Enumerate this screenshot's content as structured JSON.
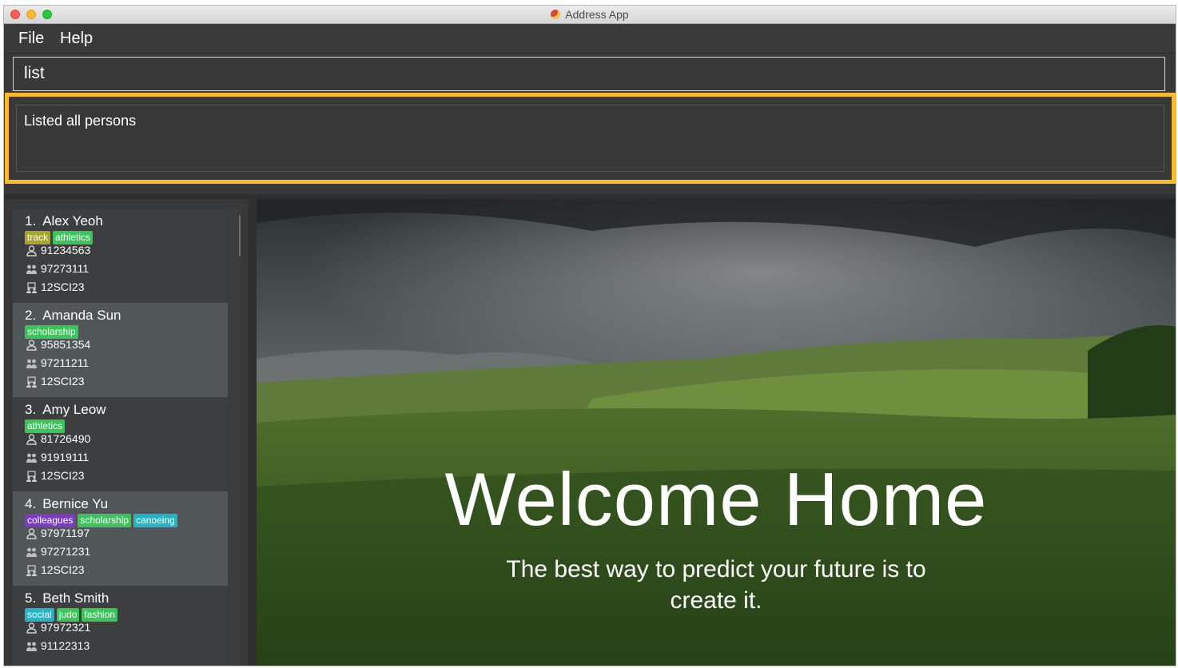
{
  "window": {
    "title": "Address App"
  },
  "menu": {
    "items": [
      "File",
      "Help"
    ]
  },
  "command": {
    "value": "list"
  },
  "result": {
    "text": "Listed all persons"
  },
  "persons": [
    {
      "index": "1.",
      "name": "Alex Yeoh",
      "tags": [
        {
          "label": "track",
          "color": "#a7a52f"
        },
        {
          "label": "athletics",
          "color": "#3cc45a"
        }
      ],
      "phone": "91234563",
      "parent_phone": "97273111",
      "class": "12SCI23"
    },
    {
      "index": "2.",
      "name": "Amanda Sun",
      "tags": [
        {
          "label": "scholarship",
          "color": "#3cc45a"
        }
      ],
      "phone": "95851354",
      "parent_phone": "97211211",
      "class": "12SCI23"
    },
    {
      "index": "3.",
      "name": "Amy Leow",
      "tags": [
        {
          "label": "athletics",
          "color": "#3cc45a"
        }
      ],
      "phone": "81726490",
      "parent_phone": "91919111",
      "class": "12SCI23"
    },
    {
      "index": "4.",
      "name": "Bernice Yu",
      "tags": [
        {
          "label": "colleagues",
          "color": "#7a3cc2"
        },
        {
          "label": "scholarship",
          "color": "#3cc45a"
        },
        {
          "label": "canoeing",
          "color": "#25b4c0"
        }
      ],
      "phone": "97971197",
      "parent_phone": "97271231",
      "class": "12SCI23"
    },
    {
      "index": "5.",
      "name": "Beth Smith",
      "tags": [
        {
          "label": "social",
          "color": "#25b4c0"
        },
        {
          "label": "judo",
          "color": "#3cc45a"
        },
        {
          "label": "fashion",
          "color": "#3cc45a"
        }
      ],
      "phone": "97972321",
      "parent_phone": "91122313",
      "class": ""
    }
  ],
  "hero": {
    "title": "Welcome Home",
    "subtitle": "The best way to predict your future is to create it."
  },
  "icons": {
    "phone": "person-icon",
    "parent_phone": "parents-icon",
    "class": "class-icon"
  },
  "colors": {
    "highlight": "#f7bb2b",
    "background": "#383838"
  }
}
